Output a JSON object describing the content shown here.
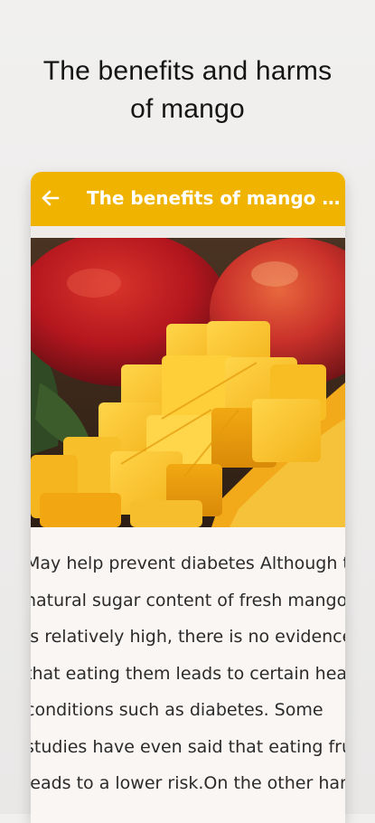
{
  "promo": {
    "title_line1": "The benefits and harms",
    "title_line2": "of mango"
  },
  "appbar": {
    "title": "The benefits of mango f...",
    "back_icon": "arrow-left-icon",
    "background": "#f0b400"
  },
  "hero_image": {
    "subject": "mango-photo"
  },
  "article": {
    "lines": [
      "May help prevent diabetes Although the",
      "natural sugar content of fresh mangoes",
      "is relatively high, there is no evidence",
      "that eating them leads to certain health",
      "conditions such as diabetes. Some",
      "studies have even said that eating fruit",
      "leads to a lower risk.On the other hand,"
    ]
  }
}
